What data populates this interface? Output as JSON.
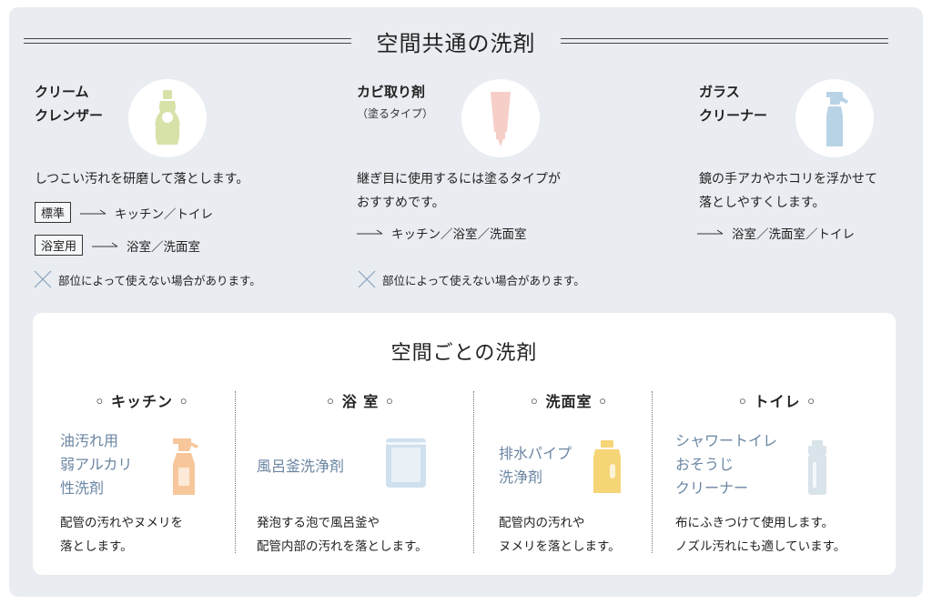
{
  "header": {
    "title": "空間共通の洗剤"
  },
  "common": [
    {
      "name_lines": [
        "クリーム",
        "クレンザー"
      ],
      "subtitle": "",
      "description_lines": [
        "しつこい汚れを研磨して落とします。"
      ],
      "usages": [
        {
          "tag": "標準",
          "places": "キッチン／トイレ"
        },
        {
          "tag": "浴室用",
          "places": "浴室／洗面室"
        }
      ],
      "note": "部位によって使えない場合があります。"
    },
    {
      "name_lines": [
        "カビ取り剤"
      ],
      "subtitle": "（塗るタイプ）",
      "description_lines": [
        "継ぎ目に使用するには塗るタイプが",
        "おすすめです。"
      ],
      "usages": [
        {
          "tag": "",
          "places": "キッチン／浴室／洗面室"
        }
      ],
      "note": "部位によって使えない場合があります。"
    },
    {
      "name_lines": [
        "ガラス",
        "クリーナー"
      ],
      "subtitle": "",
      "description_lines": [
        "鏡の手アカやホコリを浮かせて",
        "落としやすくします。"
      ],
      "usages": [
        {
          "tag": "",
          "places": "浴室／洗面室／トイレ"
        }
      ],
      "note": ""
    }
  ],
  "per_space": {
    "title": "空間ごとの洗剤",
    "sections": [
      {
        "title": "◦ キッチン ◦",
        "product_lines": [
          "油汚れ用",
          "弱アルカリ",
          "性洗剤"
        ],
        "description_lines": [
          "配管の汚れやヌメリを",
          "落とします。"
        ]
      },
      {
        "title": "◦ 浴 室 ◦",
        "product_lines": [
          "風呂釜洗浄剤"
        ],
        "description_lines": [
          "発泡する泡で風呂釜や",
          "配管内部の汚れを落とします。"
        ]
      },
      {
        "title": "◦ 洗面室 ◦",
        "product_lines": [
          "排水パイプ",
          "洗浄剤"
        ],
        "description_lines": [
          "配管内の汚れや",
          "ヌメリを落とします。"
        ]
      },
      {
        "title": "◦ トイレ ◦",
        "product_lines": [
          "シャワートイレ",
          "おそうじ",
          "クリーナー"
        ],
        "description_lines": [
          "布にふきつけて使用します。",
          "ノズル汚れにも適しています。"
        ]
      }
    ]
  },
  "colors": {
    "background": "#e9ecf1",
    "card": "#ffffff",
    "product_text": "#6b86a3",
    "cleanser_green": "#d6e2a8",
    "mold_pink": "#f6cfc8",
    "glass_blue": "#b9d3e6",
    "kitchen_orange": "#f7c79b",
    "bath_blue": "#cfe0ee",
    "pipe_yellow": "#f6d577",
    "toilet_gray": "#d9e3ea"
  },
  "icons": [
    "cleanser-bottle-icon",
    "tube-icon",
    "spray-bottle-icon",
    "cross-icon",
    "arrow-icon"
  ]
}
